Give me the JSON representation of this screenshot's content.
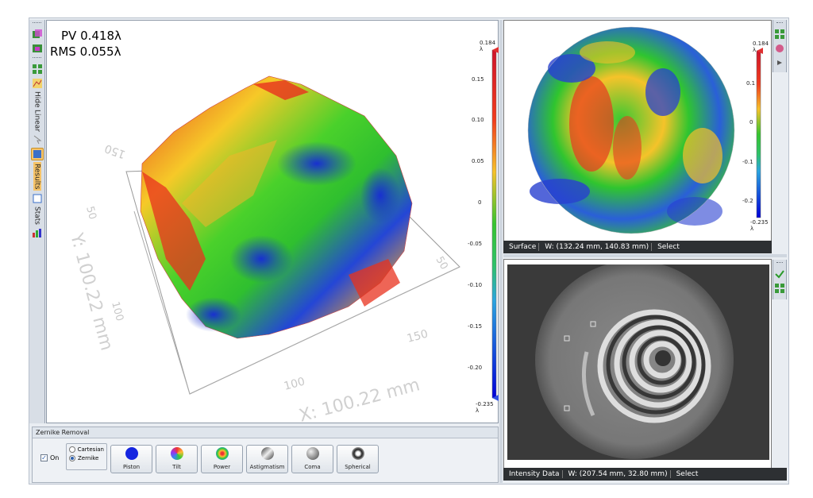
{
  "metrics": {
    "pv": "PV 0.418λ",
    "rms": "RMS 0.055λ"
  },
  "left_toolbar": {
    "hide_label": "Hide",
    "linear_label": "Linear",
    "results_label": "Results",
    "stats_label": "Stats"
  },
  "plot3d": {
    "y_axis_label": "Y: 100.22 mm",
    "x_axis_label": "X: 100.22 mm",
    "y_ticks": [
      "150",
      "50",
      "100"
    ],
    "x_ticks": [
      "100",
      "150",
      "50"
    ]
  },
  "colorbar_main": {
    "max": "0.184 λ",
    "min": "-0.235 λ",
    "ticks": [
      "0.15",
      "0.10",
      "0.05",
      "0",
      "-0.05",
      "-0.10",
      "-0.15",
      "-0.20"
    ]
  },
  "colorbar_surface": {
    "max": "0.184 λ",
    "min": "-0.235 λ",
    "ticks": [
      "0.1",
      "0",
      "-0.1",
      "-0.2"
    ]
  },
  "surface_status": {
    "name": "Surface",
    "dims": "W: (132.24 mm, 140.83 mm)",
    "select": "Select"
  },
  "intensity_status": {
    "name": "Intensity Data",
    "dims": "W: (207.54 mm, 32.80 mm)",
    "select": "Select"
  },
  "zernike": {
    "title": "Zernike Removal",
    "on_label": "On",
    "cartesian_label": "Cartesian",
    "zernike_label": "Zernike",
    "buttons": {
      "piston": "Piston",
      "tilt": "Tilt",
      "power": "Power",
      "astigmatism": "Astigmatism",
      "coma": "Coma",
      "spherical": "Spherical"
    }
  },
  "colors": {
    "statusbar": "#2d3033",
    "accent": "#3b82d6",
    "high": "#e8241a",
    "low": "#1a23d0"
  }
}
